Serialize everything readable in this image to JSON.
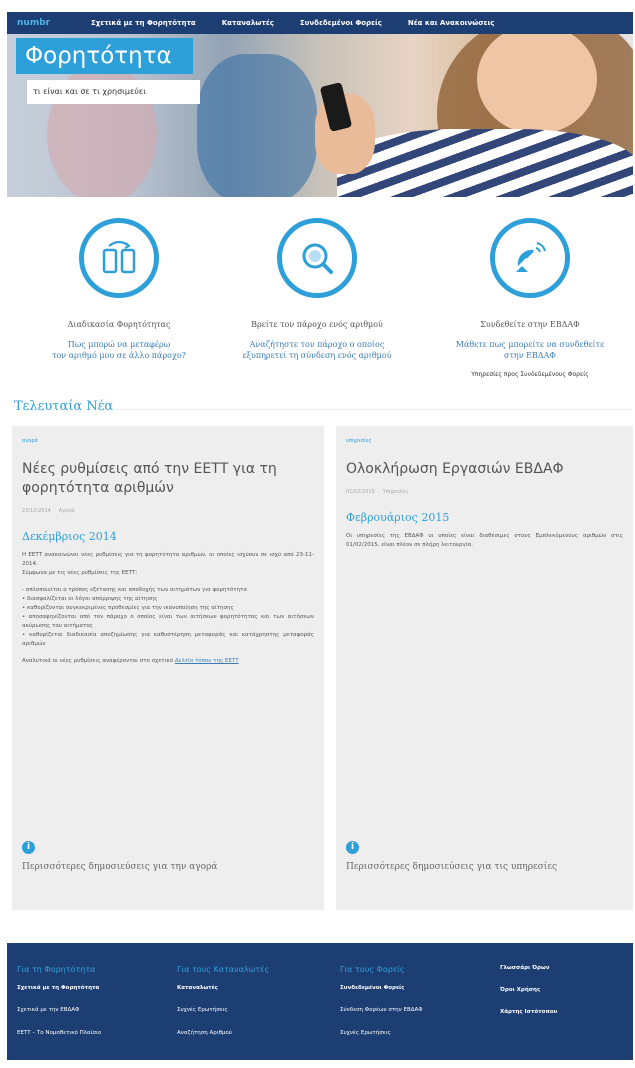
{
  "nav": {
    "logo": "numbr",
    "items": [
      "Σχετικά με τη Φορητότητα",
      "Καταναλωτές",
      "Συνδεδεμένοι Φορείς",
      "Νέα και Ανακοινώσεις"
    ]
  },
  "hero": {
    "title": "Φορητότητα",
    "subtitle": "τι είναι και σε τι χρησιμεύει"
  },
  "features": [
    {
      "title": "Διαδικασία Φορητότητας",
      "link_line1": "Πως μπορώ να μεταφέρω",
      "link_line2": "τον αριθμό μου σε άλλο πάροχο?",
      "extra": "",
      "icon": "phones-transfer-icon"
    },
    {
      "title": "Βρείτε τον πάροχο ενός αριθμού",
      "link_line1": "Αναζήτηστε τον πάροχο ο οποίος",
      "link_line2": "εξυπηρετεί τη σύνδεση ενός αριθμού",
      "extra": "",
      "icon": "search-number-icon"
    },
    {
      "title": "Συνδεθείτε στην ΕΒΔΑΦ",
      "link_line1": "Μάθετε πως μπορείτε να συνδεθείτε",
      "link_line2": "στην ΕΒΔΑΦ",
      "extra": "Υπηρεσίες προς Συνδεδεμένους Φορείς",
      "icon": "satellite-dish-icon"
    }
  ],
  "news": {
    "heading": "Τελευταία Νέα",
    "cards": [
      {
        "category": "αγορά",
        "title": "Νέες ρυθμίσεις από την ΕΕΤΤ για τη φορητότητα αριθμών",
        "meta_date": "23/12/2014",
        "meta_author": "Αγορά",
        "subheading": "Δεκέμβριος 2014",
        "p1": "Η ΕΕΤΤ ανακοινώνει νέες ρυθμίσεις για τη φορητότητα αριθμών, οι οποίες ισχύουν σε ισχύ από 23-11-2014.",
        "p2": "Σύμφωνα με τις νέες ρυθμίσεις της ΕΕΤΤ:",
        "b1": "- απλοποιείται ο τρόπος εξέτασης και αποδοχής των αιτημάτων για φορητότητα",
        "b2": "• διασφαλίζεται οι λόγοι απόρριψης της αίτησης",
        "b3": "• καθορίζονται συγκεκριμένες προθεσμίες για την ικανοποίηση της αίτησης",
        "b4": "• αποσαφηνίζονται από τον πάροχο ο οποίος είναι των αιτήσεων φορητότητας και των αιτήσεων ακύρωσης του αιτήματος",
        "b5": "• καθορίζεται διαδικασία αποζημίωσης για καθυστέρηση μεταφοράς και κατάχρηστης μεταφοράς αριθμών",
        "p3": "Αναλυτικά οι νέες ρυθμίσεις αναφέρονται στο σχετικό ",
        "link": "Δελτίο τύπου της ΕΕΤΤ",
        "more": "Περισσότερες δημοσιεύσεις για την αγορά"
      },
      {
        "category": "υπηρεσίες",
        "title": "Ολοκλήρωση Εργασιών ΕΒΔΑΦ",
        "meta_date": "01/02/2015",
        "meta_author": "Υπηρεσίες",
        "subheading": "Φεβρουάριος 2015",
        "p1": "Οι υπηρεσίες της ΕΒΔΑΦ οι οποίες είναι διαθέσιμες στους Εμπλεκόμενους αριθμών στις 01/02/2015, είναι πλέον σε πλήρη λειτουργία.",
        "more": "Περισσότερες δημοσιεύσεις για τις υπηρεσίες"
      }
    ]
  },
  "footer": {
    "col1": {
      "heading": "Για τη Φορητότητα",
      "bold": "Σχετικά με τη Φορητότητα",
      "items": [
        "Σχετικά με την ΕΒΔΑΦ",
        "ΕΕΤΤ – Το Νομοθετικό Πλαίσιο"
      ]
    },
    "col2": {
      "heading": "Για τους Καταναλωτές",
      "bold": "Καταναλωτές",
      "items": [
        "Συχνές Ερωτήσεις",
        "Αναζήτηση Αριθμού"
      ]
    },
    "col3": {
      "heading": "Για τους Φορείς",
      "bold": "Συνδεδεμένοι Φορείς",
      "items": [
        "Σύνδεση Φορέων στην ΕΒΔΑΦ",
        "Συχνές Ερωτήσεις"
      ]
    },
    "col4": {
      "items": [
        "Γλωσσάρι Όρων",
        "Όροι Χρήσης",
        "Χάρτης Ιστότοπου"
      ]
    }
  },
  "colors": {
    "nav": "#1d3e73",
    "accent": "#2d9fd9",
    "card_bg": "#eeeeee"
  }
}
